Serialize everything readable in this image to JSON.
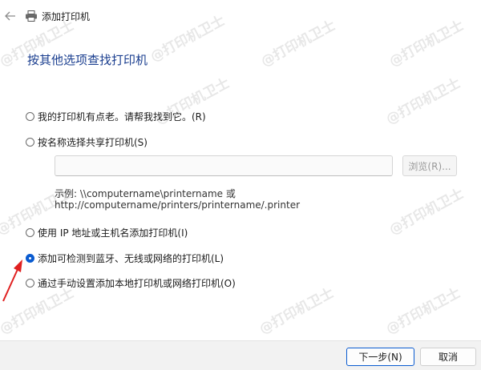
{
  "window": {
    "title": "添加打印机"
  },
  "heading": "按其他选项查找打印机",
  "options": [
    {
      "label": "我的打印机有点老。请帮我找到它。(R)",
      "checked": false
    },
    {
      "label": "按名称选择共享打印机(S)",
      "checked": false
    },
    {
      "label": "使用 IP 地址或主机名添加打印机(I)",
      "checked": false
    },
    {
      "label": "添加可检测到蓝牙、无线或网络的打印机(L)",
      "checked": true
    },
    {
      "label": "通过手动设置添加本地打印机或网络打印机(O)",
      "checked": false
    }
  ],
  "share": {
    "value": "",
    "browse_label": "浏览(R)...",
    "example_line1": "示例: \\\\computername\\printername 或",
    "example_line2": "http://computername/printers/printername/.printer"
  },
  "footer": {
    "next_label": "下一步(N)",
    "cancel_label": "取消"
  },
  "watermark": "@打印机卫士",
  "colors": {
    "accent": "#0a5bd0",
    "heading": "#1a3e8f",
    "arrow": "#e02020"
  }
}
